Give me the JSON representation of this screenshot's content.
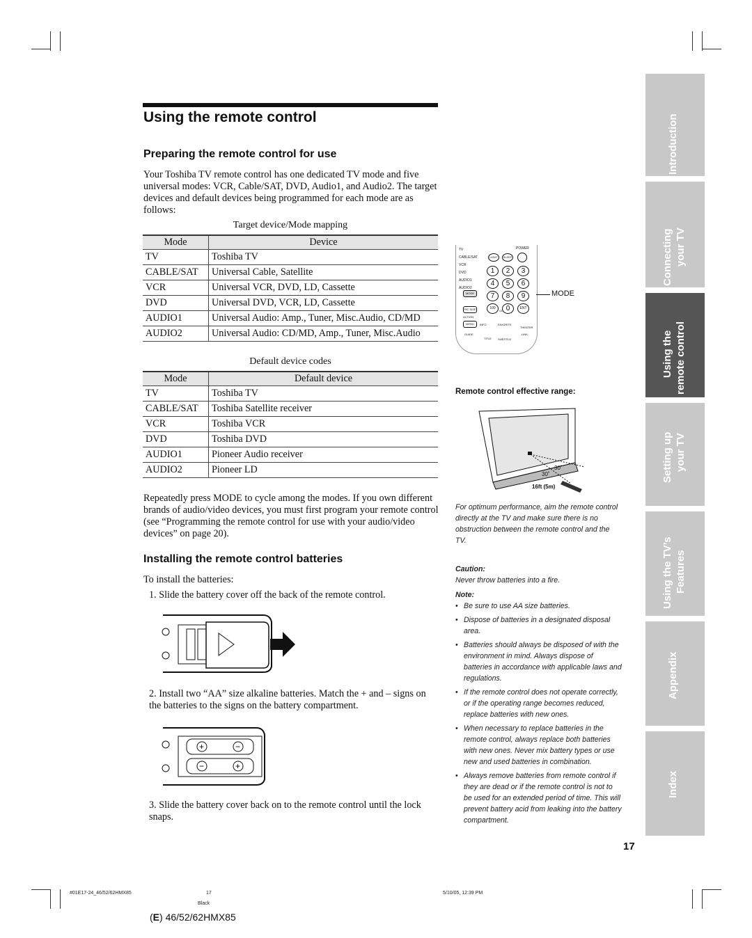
{
  "heading": "Using the remote control",
  "section1": {
    "title": "Preparing the remote control for use",
    "intro": "Your Toshiba TV remote control has one dedicated TV mode and five universal modes: VCR, Cable/SAT, DVD, Audio1, and Audio2. The target devices and default devices being programmed for each mode are as follows:"
  },
  "table1": {
    "caption": "Target device/Mode mapping",
    "headers": [
      "Mode",
      "Device"
    ],
    "rows": [
      [
        "TV",
        "Toshiba TV"
      ],
      [
        "CABLE/SAT",
        "Universal Cable, Satellite"
      ],
      [
        "VCR",
        "Universal VCR, DVD, LD, Cassette"
      ],
      [
        "DVD",
        "Universal DVD, VCR, LD, Cassette"
      ],
      [
        "AUDIO1",
        "Universal Audio: Amp., Tuner, Misc.Audio, CD/MD"
      ],
      [
        "AUDIO2",
        "Universal Audio: CD/MD, Amp., Tuner, Misc.Audio"
      ]
    ]
  },
  "table2": {
    "caption": "Default device codes",
    "headers": [
      "Mode",
      "Default device"
    ],
    "rows": [
      [
        "TV",
        "Toshiba TV"
      ],
      [
        "CABLE/SAT",
        "Toshiba Satellite receiver"
      ],
      [
        "VCR",
        "Toshiba VCR"
      ],
      [
        "DVD",
        "Toshiba  DVD"
      ],
      [
        "AUDIO1",
        "Pioneer Audio receiver"
      ],
      [
        "AUDIO2",
        "Pioneer LD"
      ]
    ]
  },
  "mode_paragraph": "Repeatedly press MODE to cycle among the modes. If you own different brands of audio/video devices, you must first program your remote control (see “Programming the remote control for use with your audio/video devices” on page 20).",
  "section2": {
    "title": "Installing the remote control batteries",
    "intro": "To install the batteries:",
    "step1": "1.  Slide the battery cover off the back of the remote control.",
    "step2": "2.  Install two “AA” size alkaline batteries. Match the + and – signs on the batteries to the signs on the battery compartment.",
    "step3": "3.  Slide the battery cover back on to the remote control until the lock snaps."
  },
  "remote_figure": {
    "mode_callout": "MODE",
    "mode_labels": [
      "TV",
      "CABLE/SAT",
      "VCR",
      "DVD",
      "AUDIO1",
      "AUDIO2"
    ],
    "keys": [
      "1",
      "2",
      "3",
      "4",
      "5",
      "6",
      "7",
      "8",
      "9",
      "100",
      "0",
      "ENT"
    ],
    "small_labels": [
      "POWER",
      "LIGHT",
      "SLEEP",
      "MODE",
      "PIC SIZE",
      "ACTION",
      "MENU",
      "INFO",
      "FAVORITE",
      "THEATER",
      "TITLE",
      "SUBTITLE",
      "GUIDE",
      "LINK",
      "/10"
    ]
  },
  "range_figure": {
    "title": "Remote control effective range:",
    "angle1": "30˚",
    "angle2": "30˚",
    "distance": "16ft (5m)"
  },
  "sidebar": {
    "optimum": "For optimum performance, aim the remote control directly at the TV and make sure there is no obstruction between the remote control and the TV.",
    "caution_label": "Caution:",
    "caution_text": "Never throw batteries into a fire.",
    "note_label": "Note:",
    "notes": [
      "Be sure to use AA size batteries.",
      "Dispose of batteries in a designated disposal area.",
      "Batteries should always be disposed of with the environment in mind. Always dispose of batteries in accordance with applicable laws and regulations.",
      "If the remote control does not operate correctly, or if the operating range becomes reduced, replace batteries with new ones.",
      "When necessary to replace batteries in the remote control, always replace both batteries with new ones. Never mix battery types or use new and used batteries in combination.",
      "Always remove batteries from remote control if they are dead or if the remote control is not to be used for an extended period of time. This will prevent battery acid from leaking into the battery compartment."
    ]
  },
  "tabs": [
    {
      "line1": "Introduction",
      "line2": ""
    },
    {
      "line1": "Connecting",
      "line2": "your TV"
    },
    {
      "line1": "Using the",
      "line2": "remote control"
    },
    {
      "line1": "Setting up",
      "line2": "your TV"
    },
    {
      "line1": "Using the TV’s",
      "line2": "Features"
    },
    {
      "line1": "Appendix",
      "line2": ""
    },
    {
      "line1": "Index",
      "line2": ""
    }
  ],
  "page_number": "17",
  "footer": {
    "file": "#01E17-24_46/52/62HMX85",
    "page": "17",
    "date": "5/10/05, 12:39 PM",
    "color": "Black",
    "model_letter": "E",
    "model": "46/52/62HMX85"
  }
}
